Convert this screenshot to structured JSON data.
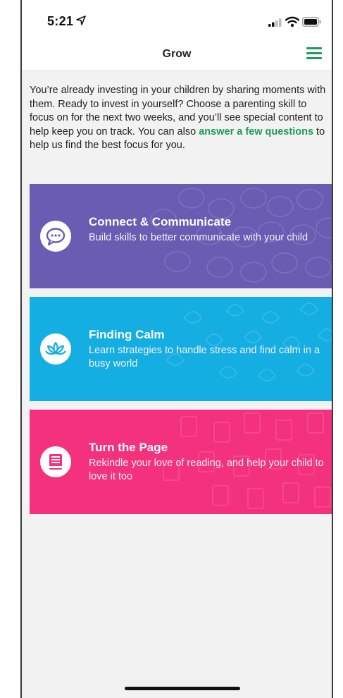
{
  "status": {
    "time": "5:21"
  },
  "header": {
    "title": "Grow"
  },
  "intro": {
    "text_before": "You’re already investing in your children by sharing moments with them. Ready to invest in yourself? Choose a parenting skill to focus on for the next two weeks, and you’ll see special content to help keep you on track. You can also ",
    "link": "answer a few questions",
    "text_after": " to help us find the best focus for you."
  },
  "cards": [
    {
      "title": "Connect & Communicate",
      "description": "Build skills to better communicate with your child",
      "color": "#6a5bb3",
      "icon": "speech-bubble-icon"
    },
    {
      "title": "Finding Calm",
      "description": "Learn strategies to handle stress and find calm in a busy world",
      "color": "#15aee3",
      "icon": "lotus-icon"
    },
    {
      "title": "Turn the Page",
      "description": "Rekindle your love of reading, and help your child to love it too",
      "color": "#f4317c",
      "icon": "book-icon"
    }
  ],
  "colors": {
    "accent": "#1e9b5b"
  }
}
